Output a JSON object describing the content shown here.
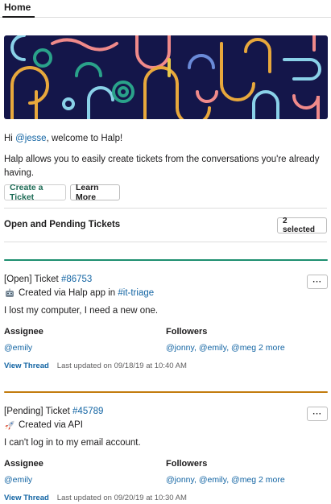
{
  "tabs": {
    "home": "Home"
  },
  "welcome": {
    "prefix": "Hi ",
    "mention": "@jesse",
    "suffix": ", welcome to Halp!"
  },
  "intro_text": "Halp allows you to easily create tickets from the conversations you're already having.",
  "buttons": {
    "create_ticket": "Create a Ticket",
    "learn_more": "Learn More"
  },
  "tickets_section": {
    "title": "Open and Pending Tickets",
    "filter_label": "2 selected"
  },
  "colors": {
    "open": "#1d8f70",
    "pending": "#c27c0e",
    "link": "#1264a3",
    "banner_bg": "#14164a"
  },
  "tickets": [
    {
      "status": "[Open] Ticket ",
      "number": "#86753",
      "source_icon": "robot-icon",
      "source_prefix": "Created via Halp app in ",
      "channel": "#it-triage",
      "description": "I lost my computer, I need a new one.",
      "assignee_label": "Assignee",
      "assignee": "@emily",
      "followers_label": "Followers",
      "followers": "@jonny, @emily, @meg 2 more",
      "view_thread": "View Thread",
      "last_updated": "Last updated on 09/18/19 at 10:40 AM",
      "more": "···"
    },
    {
      "status": "[Pending] Ticket ",
      "number": "#45789",
      "source_icon": "rocket-icon",
      "source_prefix": "Created via API",
      "channel": "",
      "description": "I can't log in to my email account.",
      "assignee_label": "Assignee",
      "assignee": "@emily",
      "followers_label": "Followers",
      "followers": "@jonny, @emily, @meg 2 more",
      "view_thread": "View Thread",
      "last_updated": "Last updated on 09/20/19 at 10:30 AM",
      "more": "···"
    }
  ]
}
